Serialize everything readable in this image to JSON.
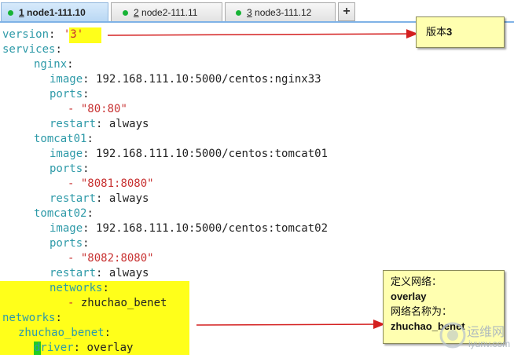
{
  "tabs": [
    {
      "num": "1",
      "label": "node1-111.10",
      "status": "connected",
      "active": true
    },
    {
      "num": "2",
      "label": "node2-111.11",
      "status": "connected",
      "active": false
    },
    {
      "num": "3",
      "label": "node3-111.12",
      "status": "connected",
      "active": false
    }
  ],
  "add_tab_label": "+",
  "code": {
    "version_key": "version",
    "version_val": "'3'",
    "services_key": "services",
    "nginx_key": "nginx",
    "image_key": "image",
    "nginx_image": "192.168.111.10:5000/centos:nginx33",
    "ports_key": "ports",
    "dash": "-",
    "nginx_port": "\"80:80\"",
    "restart_key": "restart",
    "restart_val": "always",
    "tomcat01_key": "tomcat01",
    "tomcat01_image": "192.168.111.10:5000/centos:tomcat01",
    "tomcat01_port": "\"8081:8080\"",
    "tomcat02_key": "tomcat02",
    "tomcat02_image": "192.168.111.10:5000/centos:tomcat02",
    "tomcat02_port": "\"8082:8080\"",
    "networks_key": "networks",
    "network_ref": "zhuchao_benet",
    "top_networks_key": "networks",
    "net_name_key": "zhuchao_benet",
    "driver_key": "driver",
    "driver_val": "overlay"
  },
  "callout_version": {
    "prefix": "版本",
    "value": "3"
  },
  "callout_network": {
    "line1": "定义网络：",
    "line2": "overlay",
    "line3": "网络名称为：",
    "line4": "zhuchao_benet"
  },
  "watermark": {
    "brand": "运维网",
    "domain": "iyunv.com"
  },
  "colors": {
    "key": "#2e9aa8",
    "string": "#c83232",
    "highlight": "#ffff1a",
    "callout": "#ffffb0",
    "arrow": "#d42020"
  }
}
